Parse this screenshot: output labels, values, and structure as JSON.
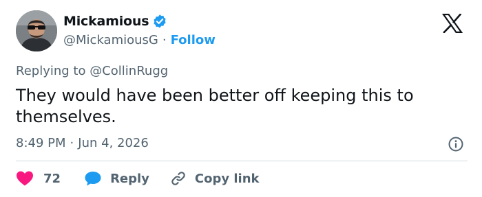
{
  "author": {
    "display_name": "Mickamious",
    "handle": "@MickamiousG",
    "separator": "·",
    "follow_label": "Follow"
  },
  "tweet": {
    "replying_prefix": "Replying to",
    "replying_to": "@CollinRugg",
    "text": "They would have been better off keeping this to themselves.",
    "time": "8:49 PM",
    "separator": "·",
    "date": "Jun 4, 2026"
  },
  "actions": {
    "like_count": "72",
    "reply_label": "Reply",
    "copy_link_label": "Copy link"
  },
  "icons": {
    "verified": "verified-badge-icon",
    "logo": "x-logo-icon",
    "info": "info-icon",
    "like": "heart-icon",
    "reply": "speech-bubble-icon",
    "copy": "link-icon"
  },
  "colors": {
    "accent": "#1d9bf0",
    "like": "#f91880",
    "text": "#0f1419",
    "muted": "#536471",
    "divider": "#cfd9de"
  }
}
